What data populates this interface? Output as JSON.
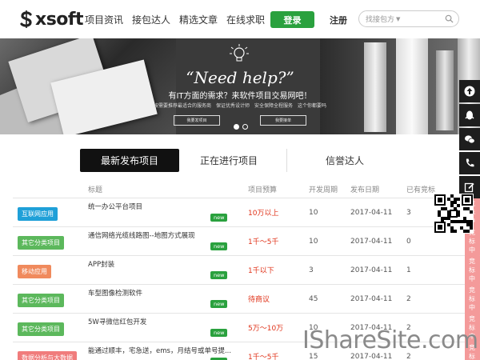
{
  "header": {
    "logo_text": "xsoft",
    "nav": [
      "项目资讯",
      "接包达人",
      "精选文章",
      "在线求职"
    ],
    "login_label": "登录",
    "register_label": "注册",
    "search_placeholder": "找接包方"
  },
  "banner": {
    "title": "“Need help?”",
    "subtitle": "有IT方面的需求？来软件项目交易网吧！",
    "tags": [
      "按需要推荐最适合的服务商",
      "保证优秀设计师",
      "安全保障全程服务",
      "这个你都要吗"
    ],
    "buttons": [
      "我要发项目",
      "我要接单"
    ],
    "slide_count": 2,
    "active_slide": 1
  },
  "tabs": [
    "最新发布项目",
    "正在进行项目",
    "信誉达人"
  ],
  "active_tab": 0,
  "table": {
    "headers": [
      "标题",
      "项目预算",
      "开发周期",
      "发布日期",
      "已有竞标"
    ],
    "rows": [
      {
        "category": "互联网应用",
        "cat_color": "#1fa0d8",
        "title": "统一办公平台项目",
        "new": "new",
        "budget": "10万以上",
        "cycle": "10",
        "date": "2017-04-11",
        "bids": "3",
        "status": "竞标中"
      },
      {
        "category": "其它分类项目",
        "cat_color": "#5cb85c",
        "title": "通信网络光缆线路图--地图方式展现",
        "new": "new",
        "budget": "1千～5千",
        "cycle": "10",
        "date": "2017-04-11",
        "bids": "0",
        "status": "竞标中"
      },
      {
        "category": "移动应用",
        "cat_color": "#f08a5d",
        "title": "APP封装",
        "new": "new",
        "budget": "1千以下",
        "cycle": "3",
        "date": "2017-04-11",
        "bids": "1",
        "status": "竞标中"
      },
      {
        "category": "其它分类项目",
        "cat_color": "#5cb85c",
        "title": "车型图像检测软件",
        "new": "new",
        "budget": "待商议",
        "cycle": "45",
        "date": "2017-04-11",
        "bids": "2",
        "status": "竞标中"
      },
      {
        "category": "其它分类项目",
        "cat_color": "#5cb85c",
        "title": "5W寻微信红包开发",
        "new": "new",
        "budget": "5万～10万",
        "cycle": "10",
        "date": "2017-04-11",
        "bids": "2",
        "status": "竞标中"
      },
      {
        "category": "数据分析与大数据",
        "cat_color": "#f07c7c",
        "title": "能通过顺丰，宅急送，ems，月结号或单号提...",
        "new": "new",
        "budget": "1千～5千",
        "cycle": "15",
        "date": "2017-04-11",
        "bids": "2",
        "status": "竞标中"
      }
    ]
  },
  "side_toolbar": [
    "arrow-up-icon",
    "qq-icon",
    "wechat-icon",
    "phone-icon",
    "edit-icon"
  ],
  "watermark": "IShareSite.com"
}
